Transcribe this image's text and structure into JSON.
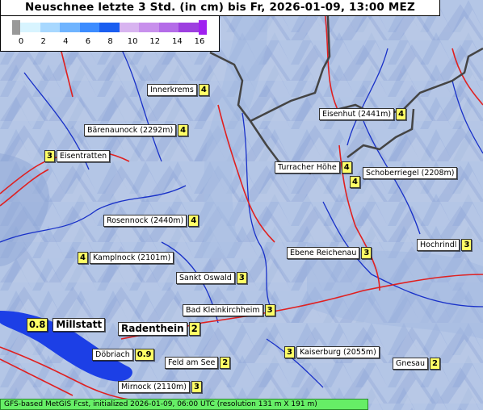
{
  "title": "Neuschnee letzte 3 Std. (in cm) bis Fr, 2026-01-09, 13:00 MEZ",
  "legend": {
    "ticks": [
      "0",
      "2",
      "4",
      "6",
      "8",
      "10",
      "12",
      "14",
      "16"
    ],
    "colors": [
      "#d8f4ff",
      "#a8d8ff",
      "#6fb4ff",
      "#3c8cff",
      "#1a5ef0",
      "#d8b4f0",
      "#c890ec",
      "#b46ce8",
      "#9d3fe0"
    ],
    "under_color": "#999999",
    "over_color": "#a020f0"
  },
  "places": [
    {
      "name": "Innerkrems",
      "value": "4"
    },
    {
      "name": "Eisenhut (2441m)",
      "value": "4"
    },
    {
      "name": "Bärenaunock (2292m)",
      "value": "4"
    },
    {
      "name": "Eisentratten",
      "value": "3"
    },
    {
      "name": "Turracher Höhe",
      "value": "4"
    },
    {
      "name": "Schoberriegel (2208m)",
      "value": "4"
    },
    {
      "name": "Rosennock (2440m)",
      "value": "4"
    },
    {
      "name": "Hochrindl",
      "value": "3"
    },
    {
      "name": "Ebene Reichenau",
      "value": "3"
    },
    {
      "name": "Kamplnock (2101m)",
      "value": "4"
    },
    {
      "name": "Sankt Oswald",
      "value": "3"
    },
    {
      "name": "Bad Kleinkirchheim",
      "value": "3"
    },
    {
      "name": "Millstatt",
      "value": "0.8"
    },
    {
      "name": "Radenthein",
      "value": "2"
    },
    {
      "name": "Kaiserburg (2055m)",
      "value": "3"
    },
    {
      "name": "Döbriach",
      "value": "0.9"
    },
    {
      "name": "Feld am See",
      "value": "2"
    },
    {
      "name": "Gnesau",
      "value": "2"
    },
    {
      "name": "Mirnock (2110m)",
      "value": "3"
    }
  ],
  "footer": "GFS-based MetGIS Fcst, initialized 2026-01-09, 06:00 UTC  (resolution 131 m X 191 m)"
}
